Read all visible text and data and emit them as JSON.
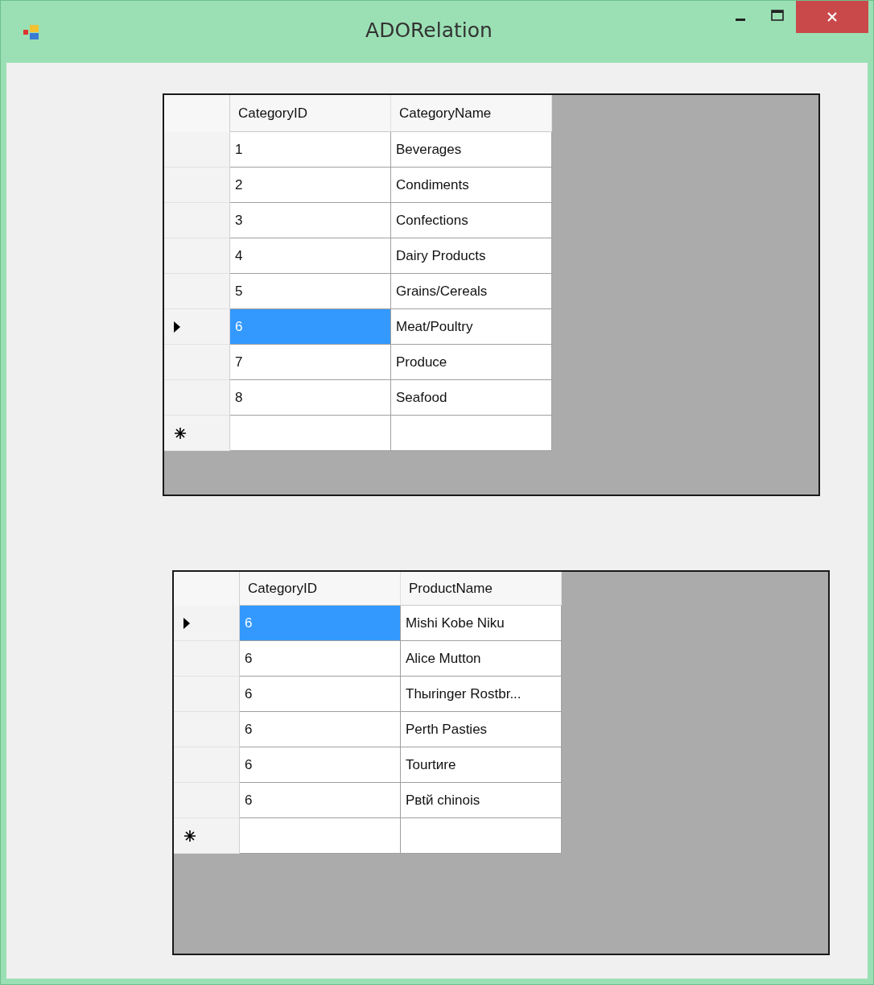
{
  "window": {
    "title": "ADORelation"
  },
  "grids": [
    {
      "columns": [
        "CategoryID",
        "CategoryName"
      ],
      "rows": [
        {
          "kind": "data",
          "selected": false,
          "cells": [
            "1",
            "Beverages"
          ]
        },
        {
          "kind": "data",
          "selected": false,
          "cells": [
            "2",
            "Condiments"
          ]
        },
        {
          "kind": "data",
          "selected": false,
          "cells": [
            "3",
            "Confections"
          ]
        },
        {
          "kind": "data",
          "selected": false,
          "cells": [
            "4",
            "Dairy Products"
          ]
        },
        {
          "kind": "data",
          "selected": false,
          "cells": [
            "5",
            "Grains/Cereals"
          ]
        },
        {
          "kind": "data",
          "selected": true,
          "cells": [
            "6",
            "Meat/Poultry"
          ]
        },
        {
          "kind": "data",
          "selected": false,
          "cells": [
            "7",
            "Produce"
          ]
        },
        {
          "kind": "data",
          "selected": false,
          "cells": [
            "8",
            "Seafood"
          ]
        },
        {
          "kind": "new",
          "selected": false,
          "cells": []
        }
      ]
    },
    {
      "columns": [
        "CategoryID",
        "ProductName"
      ],
      "rows": [
        {
          "kind": "data",
          "selected": true,
          "cells": [
            "6",
            "Mishi Kobe Niku"
          ]
        },
        {
          "kind": "data",
          "selected": false,
          "cells": [
            "6",
            "Alice Mutton"
          ]
        },
        {
          "kind": "data",
          "selected": false,
          "cells": [
            "6",
            "Thыringer Rostbr..."
          ]
        },
        {
          "kind": "data",
          "selected": false,
          "cells": [
            "6",
            "Perth Pasties"
          ]
        },
        {
          "kind": "data",
          "selected": false,
          "cells": [
            "6",
            "Tourtиre"
          ]
        },
        {
          "kind": "data",
          "selected": false,
          "cells": [
            "6",
            "Pвtй chinois"
          ]
        },
        {
          "kind": "new",
          "selected": false,
          "cells": []
        }
      ]
    }
  ]
}
